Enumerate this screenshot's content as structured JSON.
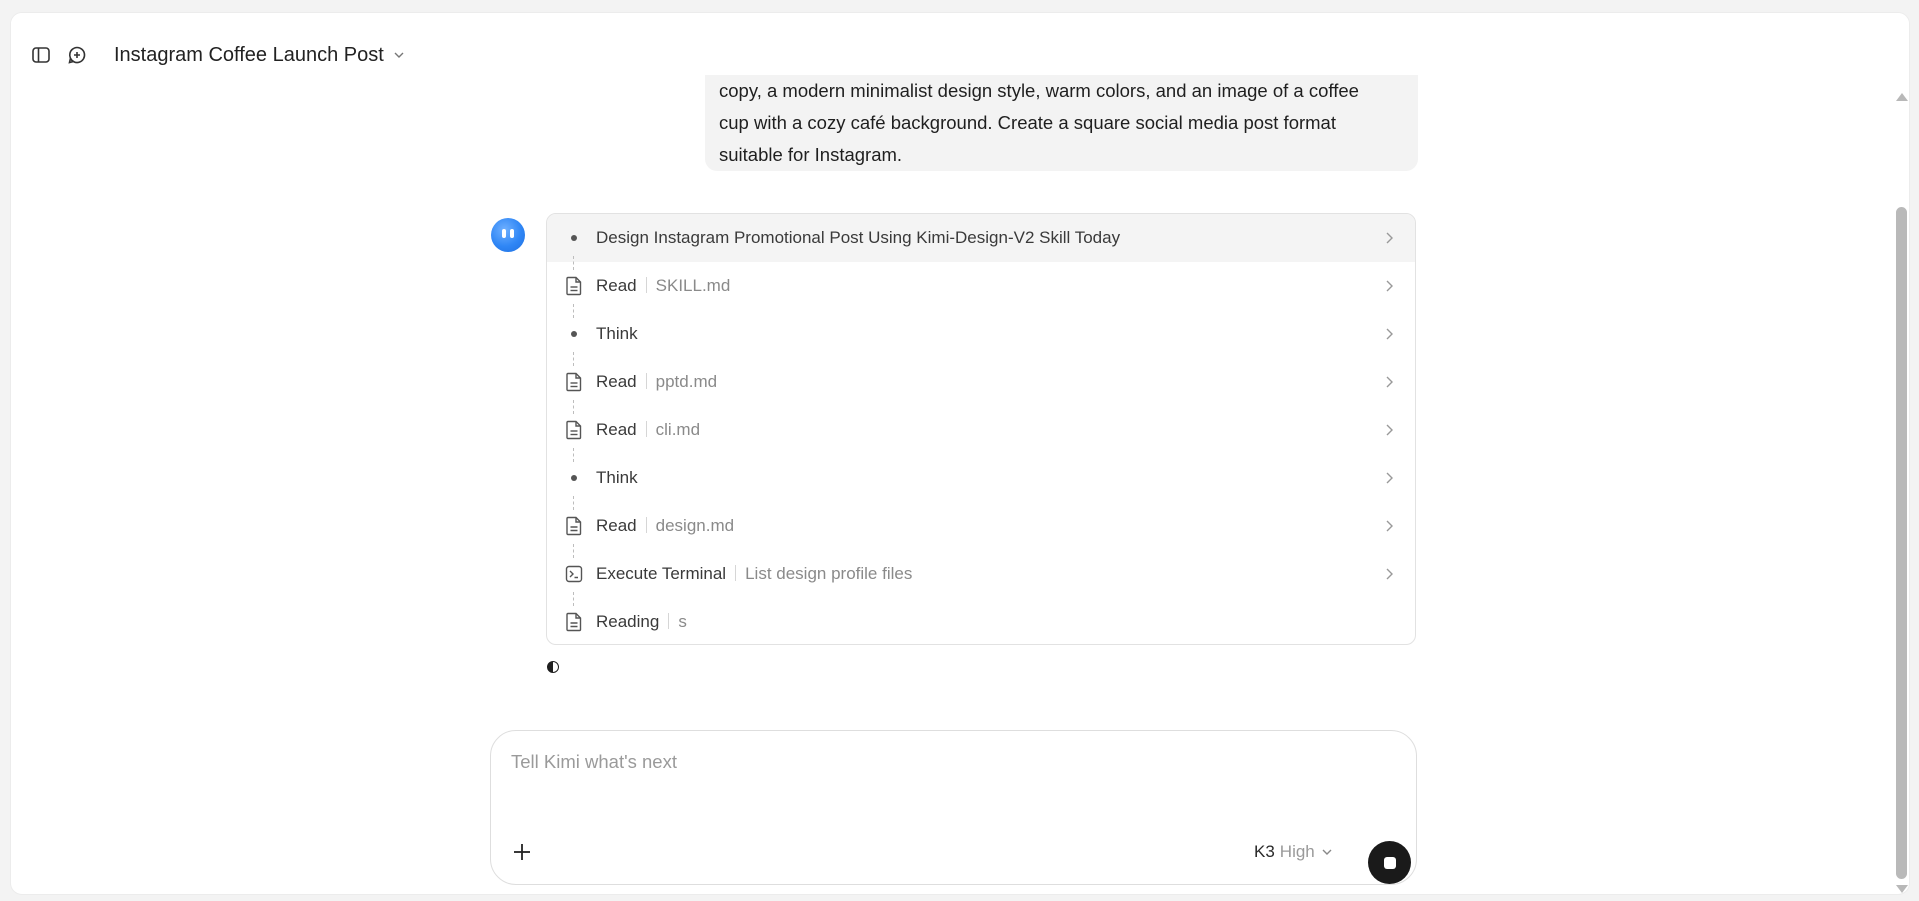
{
  "header": {
    "title": "Instagram Coffee Launch Post"
  },
  "user_message": {
    "lines": [
      "copy, a modern minimalist design style, warm colors, and an image of a coffee",
      "cup with a cozy café background. Create a square social media post format",
      "suitable for Instagram."
    ]
  },
  "steps": [
    {
      "icon": "dot",
      "label": "Design Instagram Promotional Post Using Kimi-Design-V2 Skill Today",
      "detail": ""
    },
    {
      "icon": "file",
      "label": "Read",
      "detail": "SKILL.md"
    },
    {
      "icon": "dot",
      "label": "Think",
      "detail": ""
    },
    {
      "icon": "file",
      "label": "Read",
      "detail": "pptd.md"
    },
    {
      "icon": "file",
      "label": "Read",
      "detail": "cli.md"
    },
    {
      "icon": "dot",
      "label": "Think",
      "detail": ""
    },
    {
      "icon": "file",
      "label": "Read",
      "detail": "design.md"
    },
    {
      "icon": "terminal",
      "label": "Execute Terminal",
      "detail": "List design profile files"
    },
    {
      "icon": "file",
      "label": "Reading",
      "detail": "s"
    }
  ],
  "composer": {
    "placeholder": "Tell Kimi what's next",
    "model": "K3",
    "effort": "High"
  },
  "colors": {
    "accent": "#2f86f5",
    "send_button": "#1a1a1a"
  }
}
